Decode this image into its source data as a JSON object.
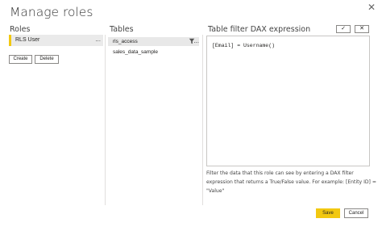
{
  "dialog": {
    "title": "Manage roles",
    "close_glyph": "✕"
  },
  "roles": {
    "label": "Roles",
    "items": [
      {
        "name": "RLS User",
        "menu_glyph": "..."
      }
    ],
    "create_label": "Create",
    "delete_label": "Delete"
  },
  "tables": {
    "label": "Tables",
    "items": [
      {
        "name": "rls_access",
        "menu_glyph": "...",
        "has_filter": true
      },
      {
        "name": "sales_data_sample"
      }
    ]
  },
  "dax": {
    "label": "Table filter DAX expression",
    "expression": "[Email] = Username()",
    "check_glyph": "✓",
    "cancel_glyph": "✕",
    "help_text": "Filter the data that this role can see by entering a DAX filter expression that returns a True/False value. For example: [Entity ID] = \"Value\""
  },
  "footer": {
    "save_label": "Save",
    "cancel_label": "Cancel"
  },
  "colors": {
    "accent": "#f2c811",
    "selected_bg": "#eaeaea",
    "border": "#8a8886"
  }
}
